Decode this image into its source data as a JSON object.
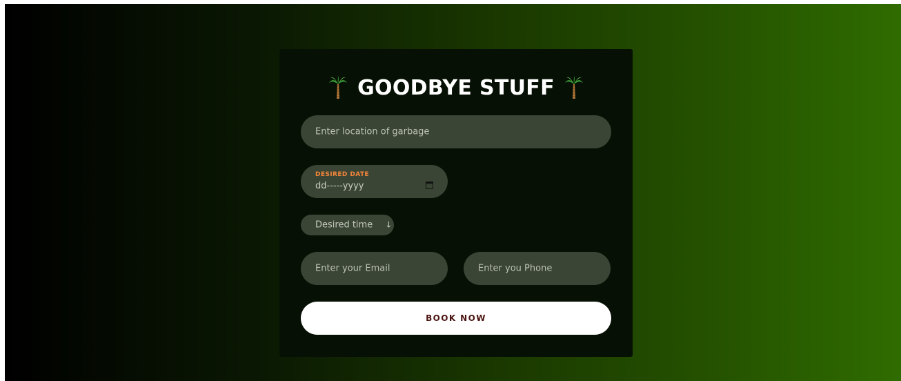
{
  "form": {
    "title": "GOODBYE STUFF",
    "title_icon_left": "palm-tree-icon",
    "title_icon_right": "palm-tree-icon",
    "location_placeholder": "Enter location of garbage",
    "date_label": "DESIRED DATE",
    "date_value": "dd-----yyyy",
    "date_icon": "calendar-icon",
    "time_label": "Desired time",
    "time_icon": "arrow-down-icon",
    "email_placeholder": "Enter your Email",
    "phone_placeholder": "Enter you Phone",
    "submit_label": "BOOK NOW"
  },
  "colors": {
    "gradient_start": "#000000",
    "gradient_end": "#2f6c00",
    "card_bg": "#071004",
    "field_bg": "#3b4535",
    "date_label": "#f5863a",
    "button_text": "#4a1410"
  }
}
